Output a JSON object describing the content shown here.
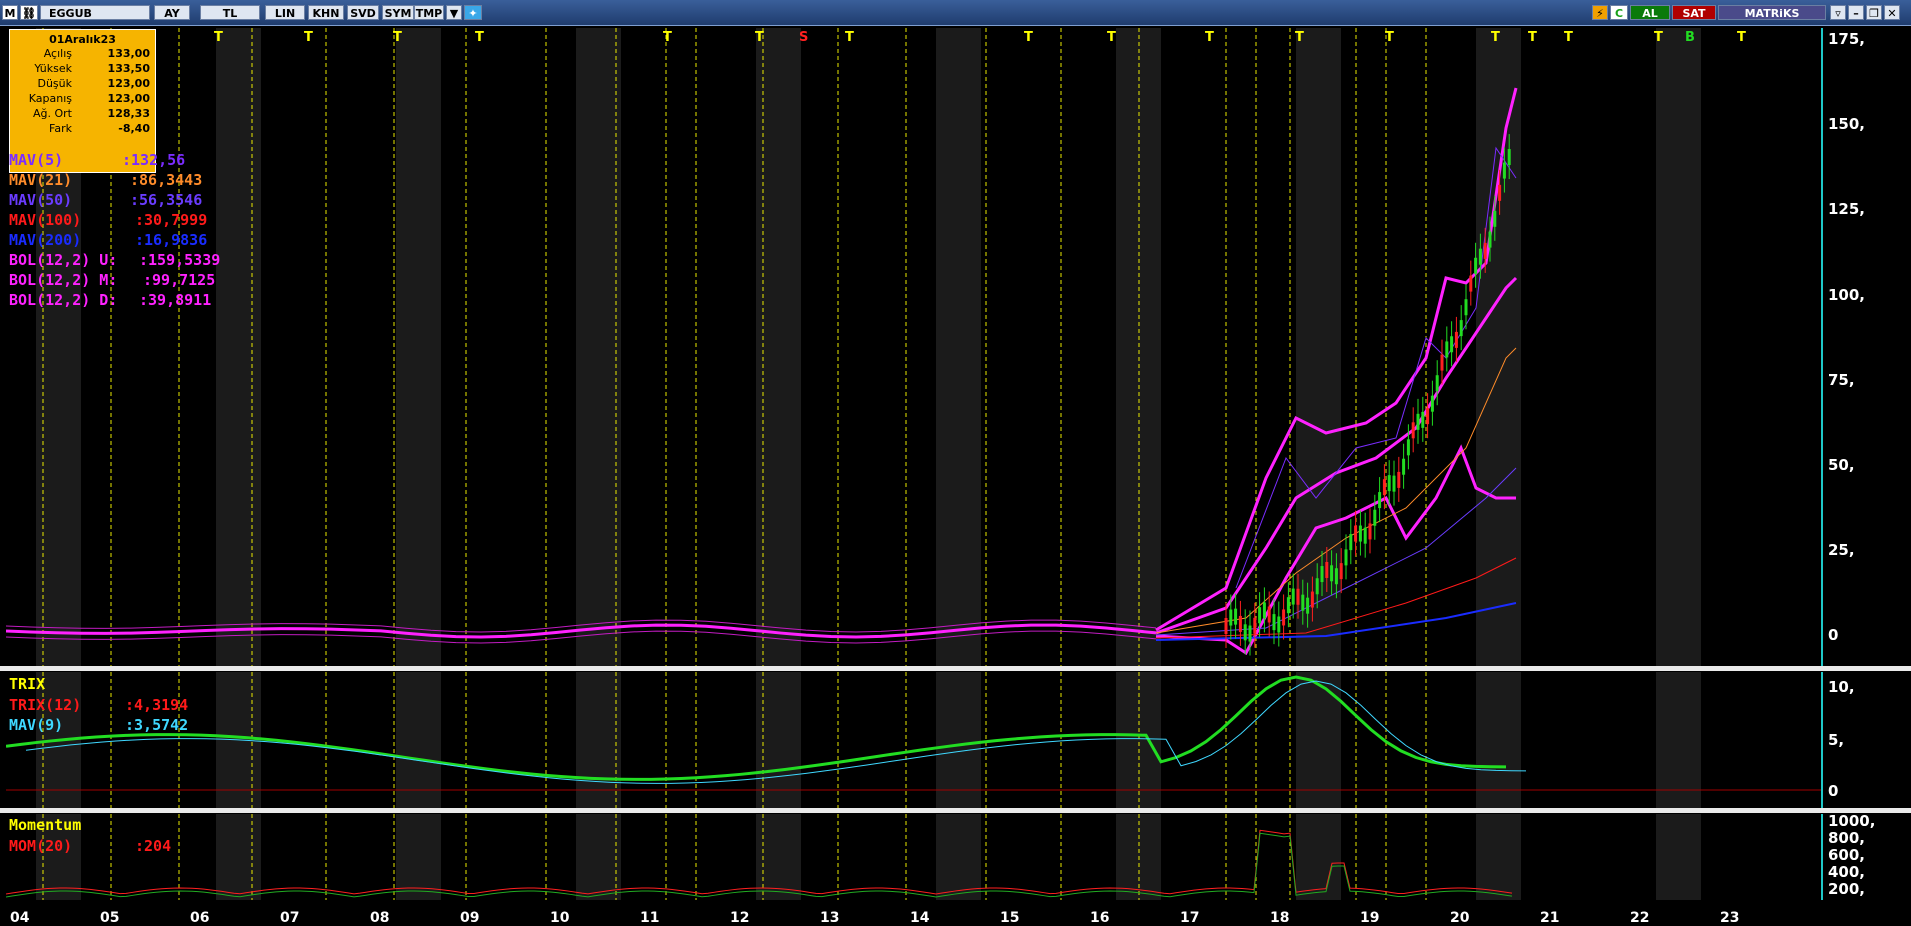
{
  "toolbar": {
    "m_label": "M",
    "symbol": "EGGUB",
    "period": "AY",
    "currency": "TL",
    "lin": "LIN",
    "khn": "KHN",
    "svd": "SVD",
    "sym": "SYM",
    "tmp": "TMP",
    "buy": "AL",
    "sell": "SAT",
    "brand": "MATRiKS"
  },
  "info_box": {
    "date": "01Aralık23",
    "rows": [
      {
        "label": "Açılış",
        "value": "133,00"
      },
      {
        "label": "Yüksek",
        "value": "133,50"
      },
      {
        "label": "Düşük",
        "value": "123,00"
      },
      {
        "label": "Kapanış",
        "value": "123,00"
      },
      {
        "label": "Ağ. Ort",
        "value": "128,33"
      },
      {
        "label": "Fark",
        "value": "-8,40"
      }
    ]
  },
  "indicators": [
    {
      "label": "MAV(5)",
      "value": ":132,56",
      "color": "#7b2cff"
    },
    {
      "label": "MAV(21)",
      "value": ":86,3443",
      "color": "#ff8c2a"
    },
    {
      "label": "MAV(50)",
      "value": ":56,3546",
      "color": "#6a3cff"
    },
    {
      "label": "MAV(100)",
      "value": ":30,7999",
      "color": "#ff1a1a"
    },
    {
      "label": "MAV(200)",
      "value": ":16,9836",
      "color": "#1a2cff"
    },
    {
      "label": "BOL(12,2) U:",
      "value": ":159,5339",
      "color": "#ff22ff"
    },
    {
      "label": "BOL(12,2) M:",
      "value": ":99,7125",
      "color": "#ff22ff"
    },
    {
      "label": "BOL(12,2) D:",
      "value": ":39,8911",
      "color": "#ff22ff"
    }
  ],
  "signals": [
    "T",
    "T",
    "T",
    "T",
    "T",
    "T",
    "S",
    "T",
    "T",
    "T",
    "T",
    "T",
    "T",
    "T",
    "T",
    "T",
    "T",
    "B",
    "T"
  ],
  "price_axis": [
    "175,",
    "150,",
    "125,",
    "100,",
    "75,",
    "50,",
    "25,",
    "0"
  ],
  "trix": {
    "title": "TRIX",
    "line1_label": "TRIX(12)",
    "line1_value": ":4,3194",
    "line2_label": "MAV(9)",
    "line2_value": ":3,5742",
    "axis": [
      "10,",
      "5,",
      "0"
    ]
  },
  "momentum": {
    "title": "Momentum",
    "line_label": "MOM(20)",
    "line_value": ":204",
    "axis": [
      "1000,",
      "800,",
      "600,",
      "400,",
      "200,"
    ]
  },
  "x_axis": [
    "04",
    "05",
    "06",
    "07",
    "08",
    "09",
    "10",
    "11",
    "12",
    "13",
    "14",
    "15",
    "16",
    "17",
    "18",
    "19",
    "20",
    "21",
    "22",
    "23"
  ],
  "colors": {
    "up": "#22dd22",
    "down": "#ff2020",
    "signal_t": "#ffff00",
    "signal_s": "#ff2020",
    "signal_b": "#22dd22"
  }
}
